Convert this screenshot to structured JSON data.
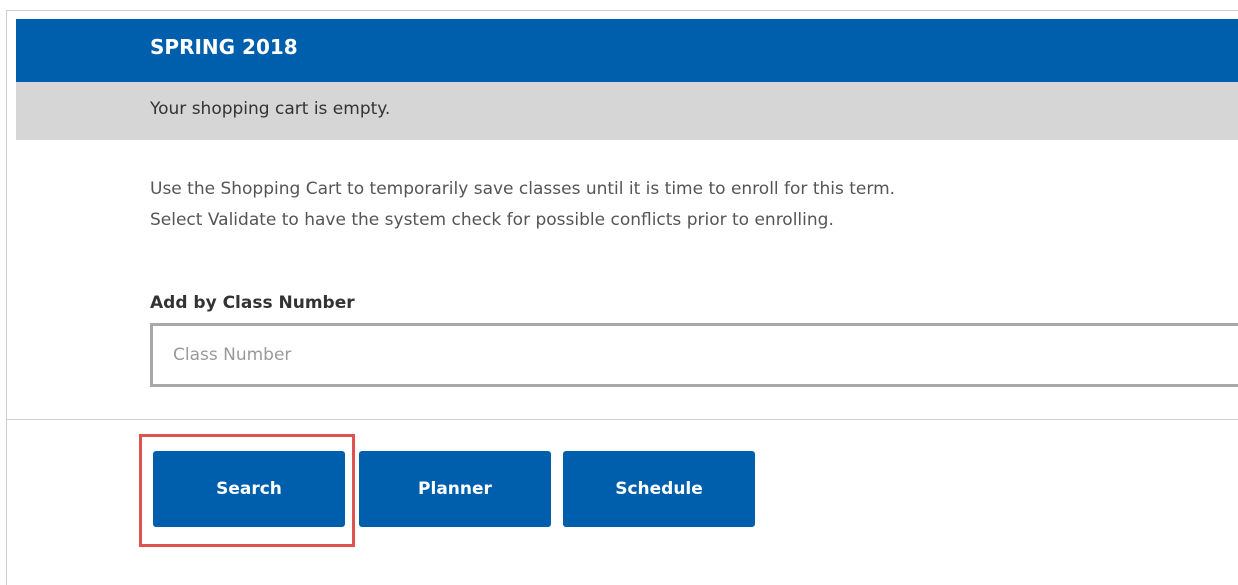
{
  "term": {
    "title": "SPRING 2018",
    "empty_message": "Your shopping cart is empty."
  },
  "info": {
    "line1": "Use the Shopping Cart to temporarily save classes until it is time to enroll for this term.",
    "line2": "Select Validate to have the system check for possible conflicts prior to enrolling."
  },
  "add_by_class": {
    "label": "Add by Class Number",
    "placeholder": "Class Number",
    "value": ""
  },
  "buttons": {
    "search": "Search",
    "planner": "Planner",
    "schedule": "Schedule"
  },
  "colors": {
    "primary": "#005fad",
    "empty_bar": "#d6d6d6",
    "highlight": "#e05250"
  }
}
